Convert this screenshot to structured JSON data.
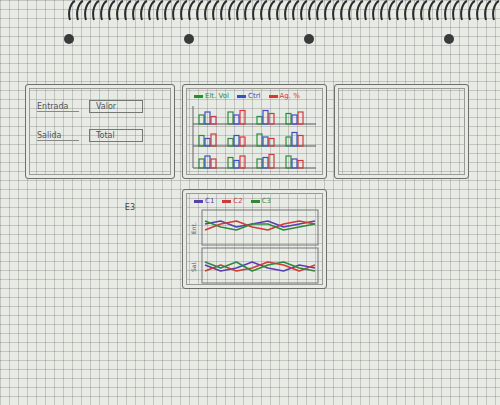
{
  "form_sketch": {
    "rows": [
      {
        "label": "Entrada",
        "box": "Valor"
      },
      {
        "label": "Salida",
        "box": "Total"
      }
    ]
  },
  "bar_sketch": {
    "legend": [
      {
        "label": "Elt. Vol",
        "color": "#2e8b3a"
      },
      {
        "label": "Ctrl",
        "color": "#3b4fc4"
      },
      {
        "label": "Ag. %",
        "color": "#d23a3a"
      }
    ],
    "groups": [
      {
        "series": [
          [
            6,
            8,
            5,
            7
          ],
          [
            8,
            6,
            9,
            6
          ],
          [
            5,
            9,
            7,
            8
          ]
        ]
      },
      {
        "series": [
          [
            7,
            5,
            8,
            6
          ],
          [
            5,
            7,
            6,
            9
          ],
          [
            8,
            6,
            5,
            7
          ]
        ]
      },
      {
        "series": [
          [
            6,
            7,
            6,
            8
          ],
          [
            8,
            5,
            7,
            6
          ],
          [
            6,
            8,
            9,
            5
          ]
        ]
      }
    ]
  },
  "side_label": "E3",
  "line_sketch": {
    "legend": [
      {
        "label": "C1",
        "color": "#5a3fb0"
      },
      {
        "label": "C2",
        "color": "#d23a3a"
      },
      {
        "label": "C3",
        "color": "#2e8b3a"
      }
    ],
    "panels": [
      {
        "axis_label": "Ent.",
        "series": [
          [
            6,
            7,
            5,
            6,
            7,
            5,
            6,
            7
          ],
          [
            4,
            6,
            7,
            5,
            4,
            6,
            7,
            6
          ],
          [
            7,
            5,
            4,
            6,
            6,
            4,
            5,
            6
          ]
        ]
      },
      {
        "axis_label": "Sal.",
        "series": [
          [
            5,
            3,
            4,
            6,
            4,
            3,
            5,
            4
          ],
          [
            3,
            5,
            3,
            4,
            6,
            5,
            3,
            5
          ],
          [
            6,
            4,
            6,
            3,
            5,
            6,
            4,
            3
          ]
        ]
      }
    ]
  }
}
